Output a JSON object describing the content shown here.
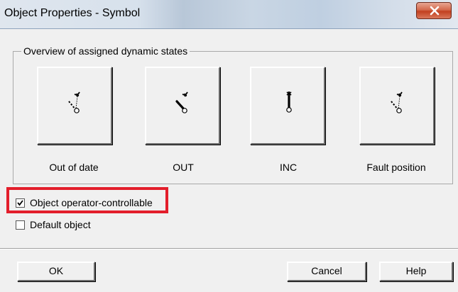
{
  "window": {
    "title": "Object Properties - Symbol",
    "close_icon": "close-x-icon"
  },
  "group": {
    "legend": "Overview of assigned dynamic states",
    "states": [
      {
        "label": "Out of date",
        "icon": "valve-out-of-date-icon"
      },
      {
        "label": "OUT",
        "icon": "valve-out-icon"
      },
      {
        "label": "INC",
        "icon": "valve-inc-icon"
      },
      {
        "label": "Fault position",
        "icon": "valve-fault-position-icon"
      }
    ]
  },
  "options": {
    "operator_controllable": {
      "label": "Object operator-controllable",
      "checked": true
    },
    "default_object": {
      "label": "Default object",
      "checked": false
    }
  },
  "annotation": {
    "highlight_color": "#e31e2b"
  },
  "buttons": {
    "ok": "OK",
    "cancel": "Cancel",
    "help": "Help"
  }
}
